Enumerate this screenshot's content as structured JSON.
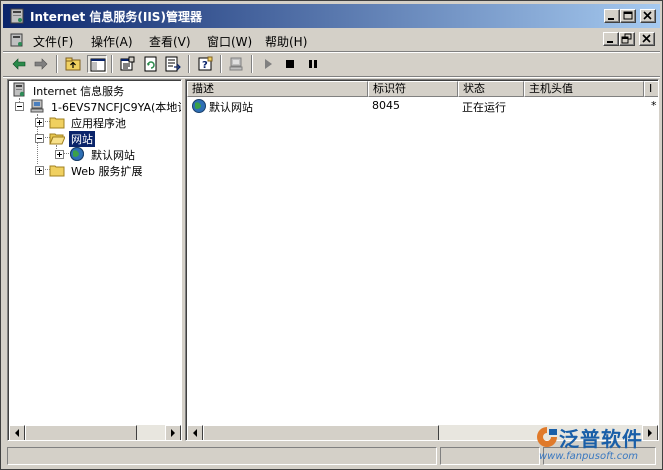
{
  "window": {
    "title": "Internet 信息服务(IIS)管理器"
  },
  "menubar": {
    "items": [
      {
        "label": "文件(F)"
      },
      {
        "label": "操作(A)"
      },
      {
        "label": "查看(V)"
      },
      {
        "label": "窗口(W)"
      },
      {
        "label": "帮助(H)"
      }
    ]
  },
  "toolbar": {
    "buttons": [
      "back-icon",
      "forward-icon",
      "up-level-icon",
      "show-hide-tree-icon",
      "properties-icon",
      "refresh-icon",
      "export-list-icon",
      "help-icon",
      "computer-icon",
      "start-icon",
      "stop-icon",
      "pause-icon"
    ]
  },
  "tree": {
    "root": "Internet 信息服务",
    "server": "1-6EVS7NCFJC9YA(本地计",
    "app_pools": "应用程序池",
    "websites": "网站",
    "default_site": "默认网站",
    "web_ext": "Web 服务扩展"
  },
  "list": {
    "columns": [
      "描述",
      "标识符",
      "状态",
      "主机头值",
      "I"
    ],
    "rows": [
      {
        "description": "默认网站",
        "identifier": "8045",
        "status": "正在运行",
        "host_header": "",
        "ip": "*"
      }
    ]
  },
  "watermark": {
    "brand": "泛普软件",
    "url": "www.fanpusoft.com"
  },
  "colors": {
    "title_active": "#0a246a",
    "selection": "#0a246a",
    "face": "#d4d0c8",
    "brand": "#1a5fa8"
  }
}
